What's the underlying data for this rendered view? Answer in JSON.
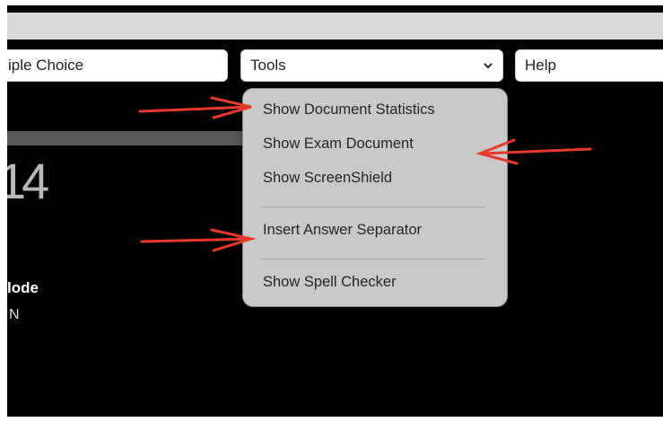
{
  "toolbar": {
    "question_type_value": "iple Choice",
    "tools_value": "Tools",
    "help_value": "Help"
  },
  "background": {
    "big_number": "14",
    "mode_label": "lode",
    "mode_sub": "N"
  },
  "menu": {
    "items": [
      "Show Document Statistics",
      "Show Exam Document",
      "Show ScreenShield",
      "Insert Answer Separator",
      "Show Spell Checker"
    ]
  },
  "colors": {
    "annotation_arrow": "#e83a2a",
    "menu_bg": "#c9c9c9",
    "page_bg": "#000000"
  }
}
